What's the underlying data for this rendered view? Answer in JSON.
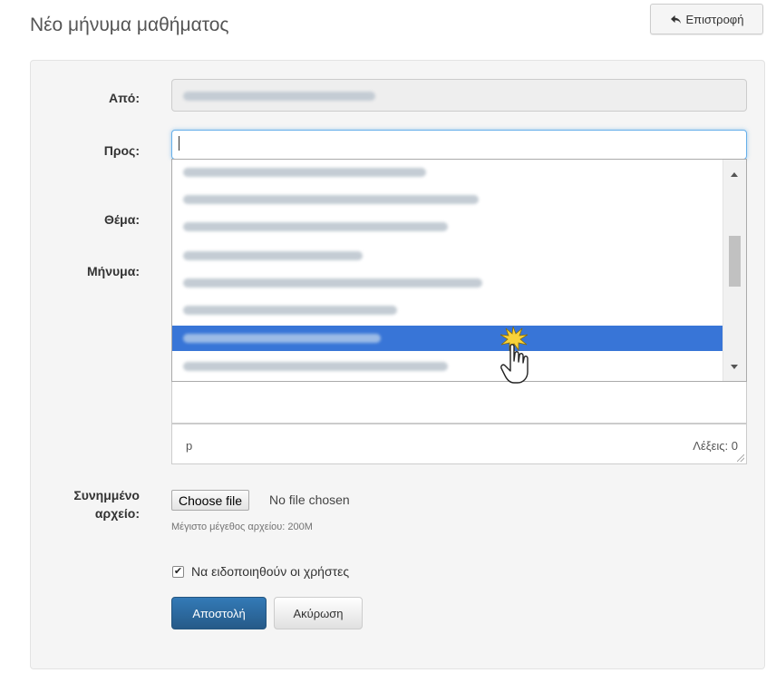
{
  "header": {
    "title": "Νέο μήνυμα μαθήματος",
    "back_label": "Επιστροφή"
  },
  "form": {
    "from_label": "Από:",
    "to_label": "Προς:",
    "subject_label": "Θέμα:",
    "message_label": "Μήνυμα:",
    "attachment_label_line1": "Συνημμένο",
    "attachment_label_line2": "αρχείο:",
    "choose_file_label": "Choose file",
    "no_file_label": "No file chosen",
    "max_size_help": "Μέγιστο μέγεθος αρχείου: 200M",
    "notify_label": "Να ειδοποιηθούν οι χρήστες",
    "notify_checked": true,
    "send_label": "Αποστολή",
    "cancel_label": "Ακύρωση"
  },
  "editor": {
    "status_path": "p",
    "word_count": "Λέξεις: 0"
  },
  "recipients_dropdown": {
    "item_count": 8,
    "selected_index": 6,
    "scroll_position": 0.36
  },
  "colors": {
    "primary": "#337ab7",
    "selected_item": "#3875d7",
    "panel_bg": "#f5f5f5"
  },
  "icons": {
    "back": "reply-arrow-icon",
    "cursor": "hand-pointer-icon"
  }
}
